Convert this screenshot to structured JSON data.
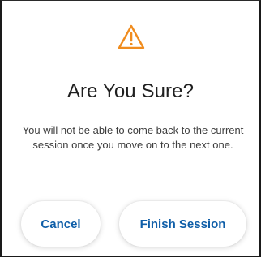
{
  "dialog": {
    "title": "Are You Sure?",
    "message": "You will not be able to come back to the current session once you move on to the next one.",
    "icon": "warning-triangle-icon",
    "accent_color": "#f08c1e",
    "buttons": {
      "cancel_label": "Cancel",
      "finish_label": "Finish Session",
      "label_color": "#0f5ea8"
    }
  }
}
